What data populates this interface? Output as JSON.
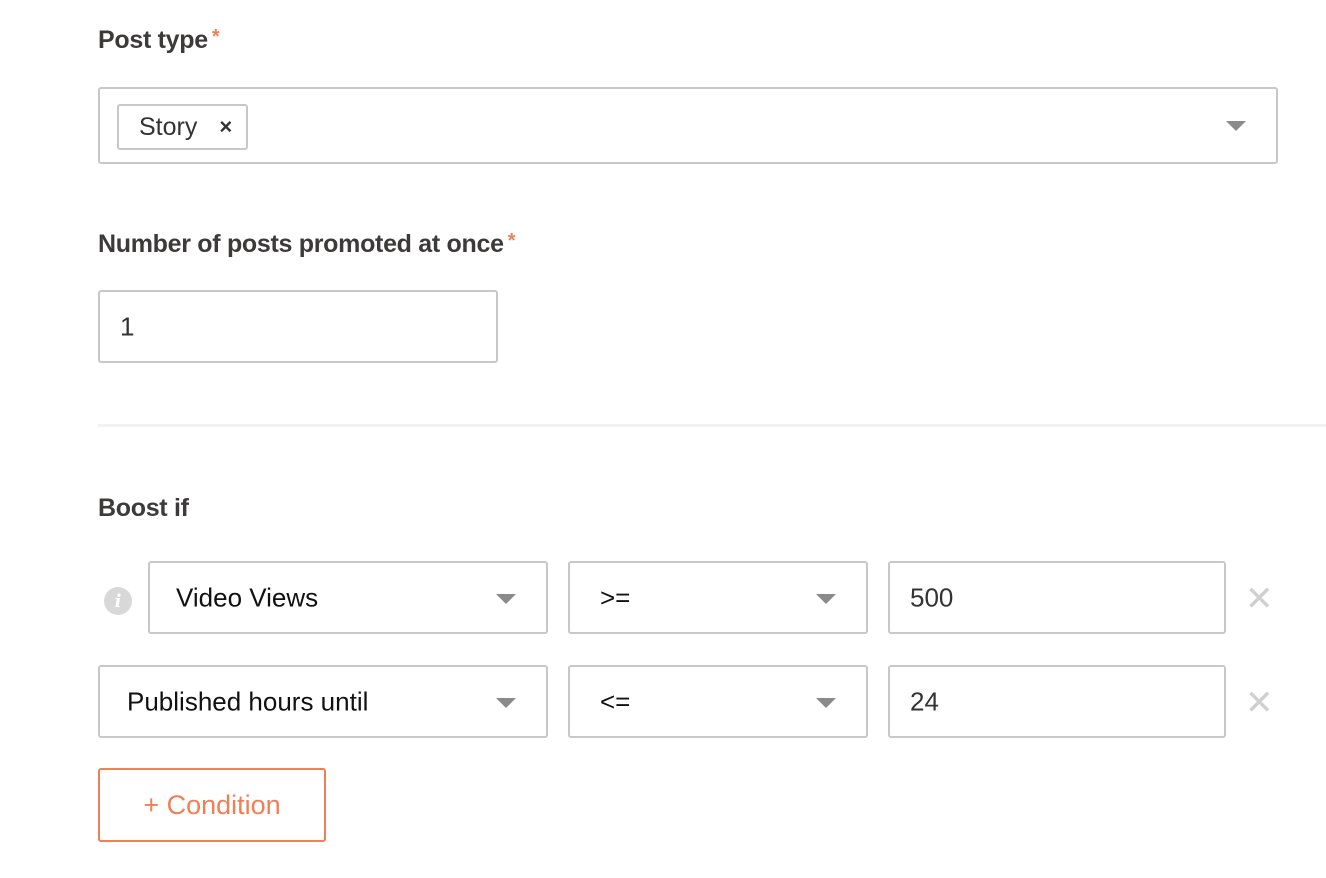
{
  "post_type": {
    "label": "Post type",
    "required_mark": "*",
    "selected_tags": [
      {
        "label": "Story",
        "remove_glyph": "×"
      }
    ]
  },
  "posts_count": {
    "label": "Number of posts promoted at once",
    "required_mark": "*",
    "value": "1"
  },
  "boost": {
    "label": "Boost if",
    "conditions": [
      {
        "metric": "Video Views",
        "operator": ">=",
        "value": "500",
        "remove_glyph": "✕"
      },
      {
        "metric": "Published hours until",
        "operator": "<=",
        "value": "24",
        "remove_glyph": "✕"
      }
    ],
    "add_condition_label": "+ Condition"
  },
  "colors": {
    "accent": "#f07f55",
    "border": "#c8c8c8",
    "caret": "#8a8a8a"
  }
}
